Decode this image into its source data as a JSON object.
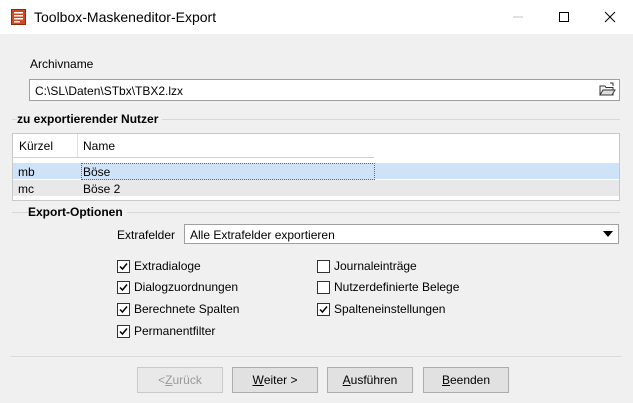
{
  "window": {
    "title": "Toolbox-Maskeneditor-Export"
  },
  "archive": {
    "label": "Archivname",
    "value": "C:\\SL\\Daten\\STbx\\TBX2.lzx"
  },
  "users_group": {
    "title": "zu exportierender Nutzer",
    "columns": [
      "Kürzel",
      "Name"
    ],
    "rows": [
      {
        "kuerzel": "mb",
        "name": "Böse"
      },
      {
        "kuerzel": "mc",
        "name": "Böse 2"
      }
    ]
  },
  "options_group": {
    "title": "Export-Optionen",
    "extrafelder_label": "Extrafelder",
    "extrafelder_value": "Alle Extrafelder exportieren",
    "checkboxes": [
      {
        "label": "Extradialoge",
        "checked": true
      },
      {
        "label": "Dialogzuordnungen",
        "checked": true
      },
      {
        "label": "Berechnete Spalten",
        "checked": true
      },
      {
        "label": "Permanentfilter",
        "checked": true
      },
      {
        "label": "Journaleinträge",
        "checked": false
      },
      {
        "label": "Nutzerdefinierte Belege",
        "checked": false
      },
      {
        "label": "Spalteneinstellungen",
        "checked": true
      }
    ]
  },
  "buttons": {
    "back_prefix": "< ",
    "back_mnemonic": "Z",
    "back_rest": "urück",
    "next_mnemonic": "W",
    "next_rest": "eiter >",
    "run_mnemonic": "A",
    "run_rest": "usführen",
    "end_mnemonic": "B",
    "end_rest": "eenden"
  },
  "colors": {
    "selection": "#cfe3f8",
    "alt_row": "#e8e8e8",
    "app_icon": "#d04a1f"
  }
}
